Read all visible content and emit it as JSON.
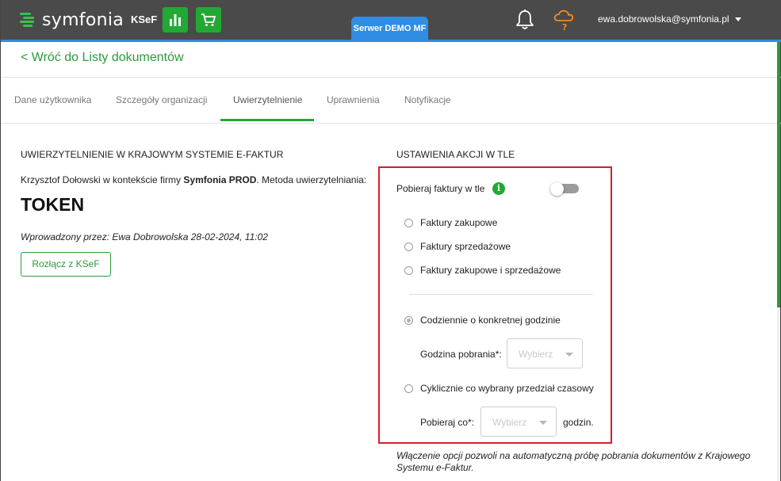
{
  "header": {
    "logo_text": "symfonia",
    "app_label": "KSeF",
    "server_tab": "Serwer DEMO MF",
    "user_email": "ewa.dobrowolska@symfonia.pl",
    "icons": [
      "bar-chart-icon",
      "cart-icon",
      "bell-icon",
      "cloud-question-icon"
    ]
  },
  "back_link": "< Wróć do Listy dokumentów",
  "tabs": [
    {
      "label": "Dane użytkownika"
    },
    {
      "label": "Szczegóły organizacji"
    },
    {
      "label": "Uwierzytelnienie"
    },
    {
      "label": "Uprawnienia"
    },
    {
      "label": "Notyfikacje"
    }
  ],
  "active_tab": "Uwierzytelnienie",
  "auth": {
    "title": "UWIERZYTELNIENIE W KRAJOWYM SYSTEMIE E-FAKTUR",
    "desc_prefix": "Krzysztof Dołowski w kontekście firmy ",
    "desc_company": "Symfonia PROD",
    "desc_suffix": ". Metoda uwierzytelniania:",
    "method": "TOKEN",
    "entered_by": "Wprowadzony przez: Ewa Dobrowolska 28-02-2024, 11:02",
    "disconnect_button": "Rozłącz z KSeF"
  },
  "background": {
    "title": "USTAWIENIA AKCJI W TLE",
    "fetch_label": "Pobieraj faktury w tle",
    "toggle_on": false,
    "invoice_types": [
      {
        "label": "Faktury zakupowe",
        "checked": false
      },
      {
        "label": "Faktury sprzedażowe",
        "checked": false
      },
      {
        "label": "Faktury zakupowe i sprzedażowe",
        "checked": false
      }
    ],
    "daily": {
      "label": "Codziennie o konkretnej godzinie",
      "checked": true
    },
    "hour_label": "Godzina pobrania*:",
    "hour_placeholder": "Wybierz",
    "cyclic": {
      "label": "Cyklicznie co wybrany przedział czasowy",
      "checked": false
    },
    "every_label": "Pobieraj co*:",
    "every_placeholder": "Wybierz",
    "every_unit": "godzin.",
    "note": "Włączenie opcji pozwoli na automatyczną próbę pobrania dokumentów z Krajowego Systemu e-Faktur."
  },
  "colors": {
    "accent_green": "#22a935",
    "link_green": "#2a9b3a",
    "header_bg": "#4a4a4a",
    "server_blue": "#2f8de4",
    "highlight_red": "#d81f26"
  }
}
